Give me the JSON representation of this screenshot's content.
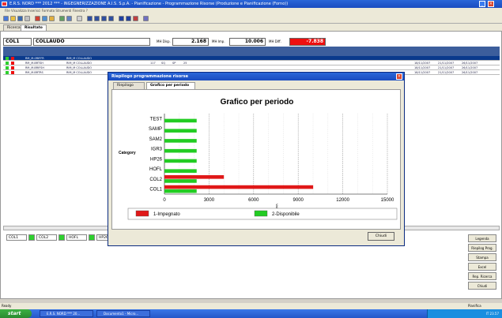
{
  "window": {
    "title": "E.R.S. NORD *** 2012 *** - INGEGNERIZZAZIONE A.I.S. S.p.A. - Pianificazione - Programmazione Risorse (Produzione e Pianificazione (Forno))"
  },
  "menubar": "File  Visualizza  Inserisci  Formato  Strumenti  Finestra  ?",
  "tabs": [
    {
      "label": "Ricerca"
    },
    {
      "label": "Risultato"
    }
  ],
  "header": {
    "code": "COL1",
    "description": "COLLAUDO",
    "disp_label": "MH Disp.",
    "disp_value": "2.168",
    "imp_label": "MH Imp.",
    "imp_value": "10.006",
    "diff_label": "MH Diff.",
    "diff_value": "-7.838"
  },
  "grid": {
    "rows": [
      {
        "code": "RM_M-0RIFFR",
        "desc": "RIM_M COLLAUDO",
        "a": "",
        "b": "",
        "c": "",
        "num": "",
        "d1": "",
        "d2": "",
        "d3": ""
      },
      {
        "code": "RM_M-BRTSH",
        "desc": "RIM_M COLLAUDO",
        "a": "117",
        "b": "SQ",
        "c": "SP",
        "num": "25",
        "d1": "18/11/2007",
        "d2": "21/11/2007",
        "d3": "26/11/2007"
      },
      {
        "code": "RM_M-BRIFSH",
        "desc": "RIM_M COLLAUDO",
        "a": "117",
        "b": "SQ",
        "c": "SP",
        "num": "120",
        "d1": "18/11/2007",
        "d2": "21/11/2007",
        "d3": "26/11/2007"
      },
      {
        "code": "RM_M-BRTRS",
        "desc": "RIM_M COLLAUDO",
        "a": "117",
        "b": "SQ",
        "c": "SP",
        "num": "17",
        "d1": "18/11/2007",
        "d2": "21/11/2007",
        "d3": "26/11/2007"
      }
    ]
  },
  "legend_items": [
    "COL1",
    "COL2",
    "HOFL",
    "HP26"
  ],
  "side_buttons": [
    "Legenda",
    "Riepilog Prog.",
    "Stampa",
    "Excel",
    "Rep. Ricerca",
    "Chiudi"
  ],
  "statusbar": "Ready",
  "statusbar_right": "Pianifica",
  "taskbar": {
    "start": "start",
    "tasks": [
      "E.R.S. NORD *** 20...",
      "Documento1 - Micro..."
    ],
    "tray": "IT  23.57"
  },
  "dialog": {
    "title": "Riepilogo programmazione risorse",
    "tabs": [
      "Riepilogo",
      "Grafico per periodo"
    ],
    "ok_label": "Chiudi"
  },
  "chart_data": {
    "type": "bar",
    "orientation": "horizontal",
    "title": "Grafico per periodo",
    "ylabel": "Category",
    "xlabel": "Valori",
    "categories": [
      "TEST",
      "SAMP",
      "SAM2",
      "IGR3",
      "HP26",
      "HOFL",
      "COL2",
      "COL1"
    ],
    "xlim": [
      0,
      15000
    ],
    "xticks": [
      0,
      3000,
      6000,
      9000,
      12000,
      15000
    ],
    "series": [
      {
        "name": "1-Impegnato",
        "color": "#e01818",
        "values": [
          0,
          0,
          0,
          0,
          0,
          0,
          4000,
          10006
        ]
      },
      {
        "name": "2-Disponibile",
        "color": "#22cc22",
        "values": [
          2168,
          2168,
          2168,
          2168,
          2168,
          2168,
          2168,
          2168
        ]
      }
    ],
    "grid": true,
    "legend": "bottom"
  }
}
